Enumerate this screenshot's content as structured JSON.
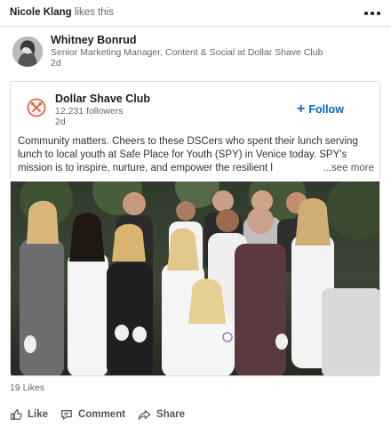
{
  "activity": {
    "actor": "Nicole Klang",
    "action": "likes this"
  },
  "author": {
    "name": "Whitney Bonrud",
    "headline": "Senior Marketing Manager, Content & Social at Dollar Shave Club",
    "time": "2d"
  },
  "shared": {
    "company": "Dollar Shave Club",
    "followers": "12,231 followers",
    "time": "2d",
    "follow_label": "Follow",
    "text": "Community matters. Cheers to these DSCers who spent their lunch serving lunch to local youth at Safe Place for Youth (SPY) in Venice today. SPY's mission is to inspire, nurture, and empower the resilient l",
    "see_more": "...see more"
  },
  "social": {
    "likes": "19 Likes"
  },
  "actions": {
    "like": "Like",
    "comment": "Comment",
    "share": "Share"
  },
  "colors": {
    "link": "#0a66c2",
    "brand": "#e8643c"
  },
  "icons": [
    "more-icon",
    "dollar-shave-club-logo",
    "plus-icon",
    "like-icon",
    "comment-icon",
    "share-icon"
  ]
}
